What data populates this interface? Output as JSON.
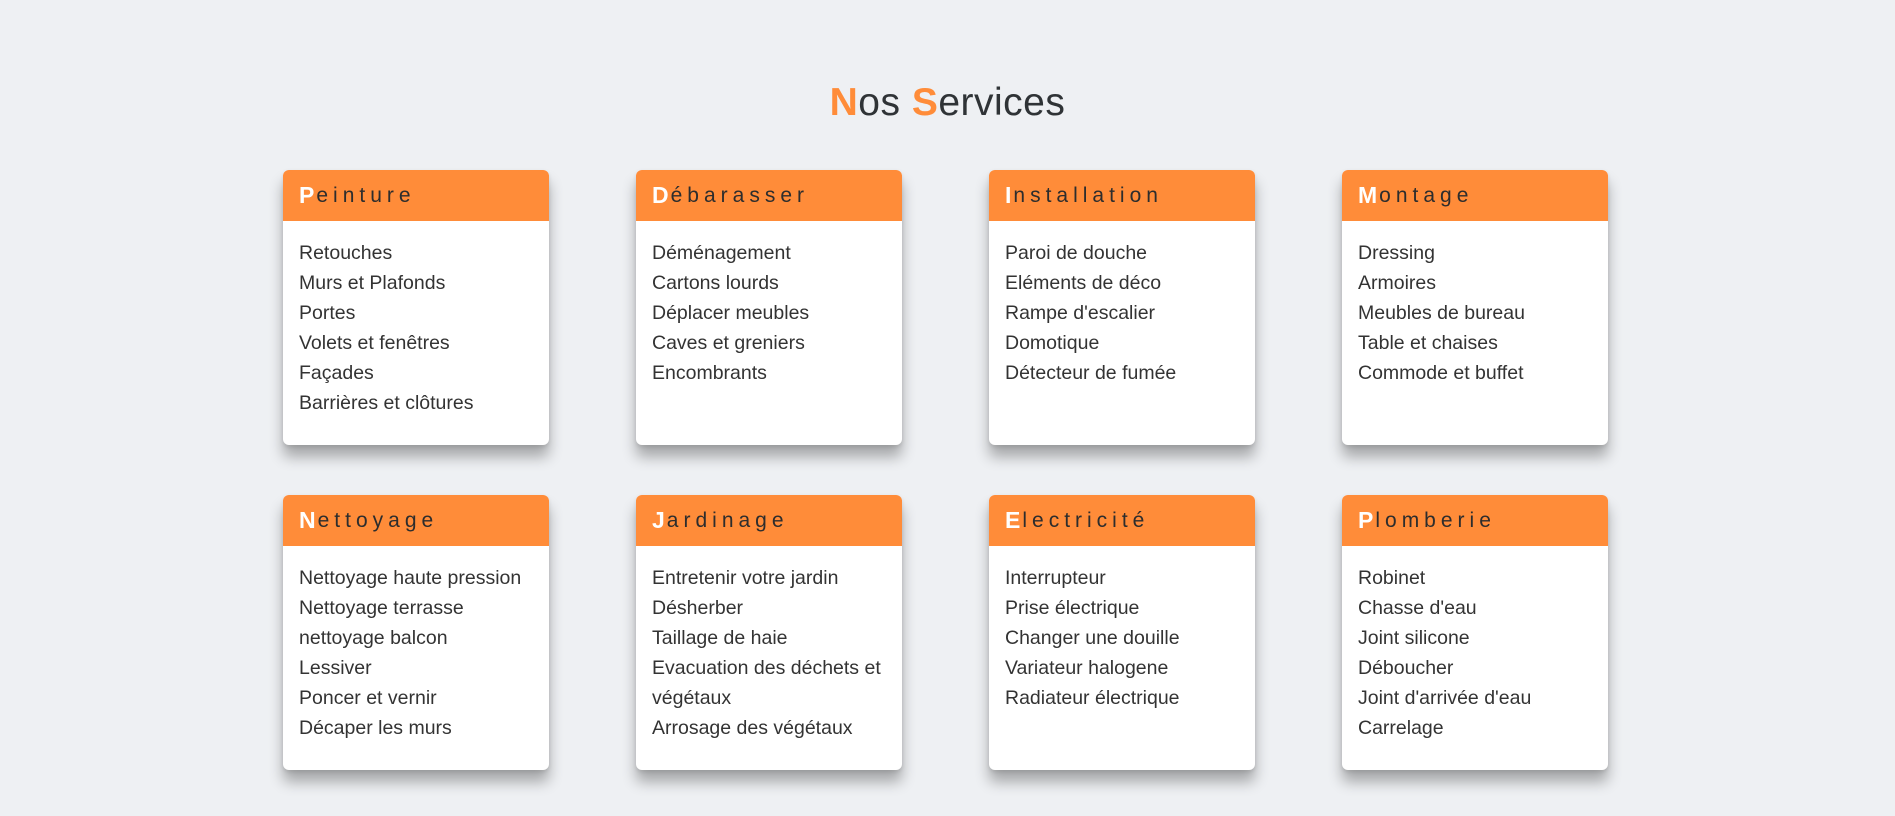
{
  "page": {
    "title_parts": [
      {
        "text": "N",
        "accent": true
      },
      {
        "text": "os ",
        "accent": false
      },
      {
        "text": "S",
        "accent": true
      },
      {
        "text": "ervices",
        "accent": false
      }
    ]
  },
  "colors": {
    "accent": "#ff8c39",
    "background": "#eef0f3",
    "card": "#ffffff"
  },
  "cards": [
    {
      "initial": "P",
      "rest": "einture",
      "items": [
        "Retouches",
        "Murs et Plafonds",
        "Portes",
        "Volets et fenêtres",
        "Façades",
        "Barrières et clôtures"
      ]
    },
    {
      "initial": "D",
      "rest": "ébarasser",
      "items": [
        "Déménagement",
        "Cartons lourds",
        "Déplacer meubles",
        "Caves et greniers",
        "Encombrants"
      ]
    },
    {
      "initial": "I",
      "rest": "nstallation",
      "items": [
        "Paroi de douche",
        "Eléments de déco",
        "Rampe d'escalier",
        "Domotique",
        "Détecteur de fumée"
      ]
    },
    {
      "initial": "M",
      "rest": "ontage",
      "items": [
        "Dressing",
        "Armoires",
        "Meubles de bureau",
        "Table et chaises",
        "Commode et buffet"
      ]
    },
    {
      "initial": "N",
      "rest": "ettoyage",
      "items": [
        "Nettoyage haute pression",
        "Nettoyage terrasse",
        "nettoyage balcon",
        "Lessiver",
        "Poncer et vernir",
        "Décaper les murs"
      ]
    },
    {
      "initial": "J",
      "rest": "ardinage",
      "items": [
        "Entretenir votre jardin",
        "Désherber",
        "Taillage de haie",
        "Evacuation des déchets et végétaux",
        "Arrosage des végétaux"
      ]
    },
    {
      "initial": "E",
      "rest": "lectricité",
      "items": [
        "Interrupteur",
        "Prise électrique",
        "Changer une douille",
        "Variateur halogene",
        "Radiateur électrique"
      ]
    },
    {
      "initial": "P",
      "rest": "lomberie",
      "items": [
        "Robinet",
        "Chasse d'eau",
        "Joint silicone",
        "Déboucher",
        "Joint d'arrivée d'eau",
        "Carrelage"
      ]
    }
  ]
}
